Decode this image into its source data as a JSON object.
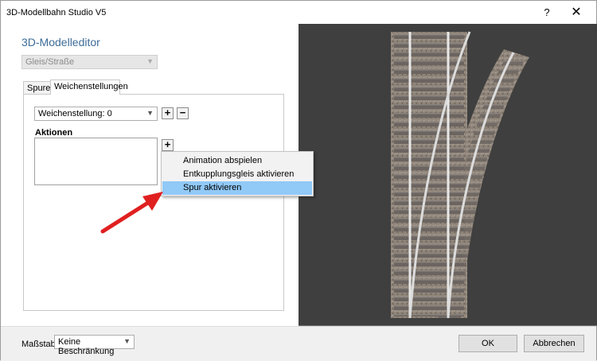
{
  "window": {
    "title": "3D-Modellbahn Studio V5",
    "help": "?",
    "close": "✕"
  },
  "editor": {
    "title": "3D-Modelleditor",
    "category": "Gleis/Straße",
    "tabs": [
      "Spuren",
      "Weichenstellungen"
    ],
    "active_tab": 1,
    "switch_setting": "Weichenstellung: 0",
    "add_label": "+",
    "remove_label": "−",
    "actions_label": "Aktionen",
    "actions_add_label": "+"
  },
  "context_menu": {
    "items": [
      "Animation abspielen",
      "Entkupplungsgleis aktivieren",
      "Spur aktivieren"
    ],
    "highlighted": 2
  },
  "footer": {
    "scale_label": "Maßstab:",
    "scale_value": "Keine Beschränkung",
    "ok": "OK",
    "cancel": "Abbrechen"
  },
  "colors": {
    "accent_title": "#3d6c97",
    "menu_highlight": "#91c9f7",
    "viewport_bg": "#3f3f3f",
    "arrow": "#e02020"
  },
  "icons": [
    "chevron-down-icon",
    "plus-icon",
    "minus-icon",
    "close-icon",
    "help-icon"
  ]
}
